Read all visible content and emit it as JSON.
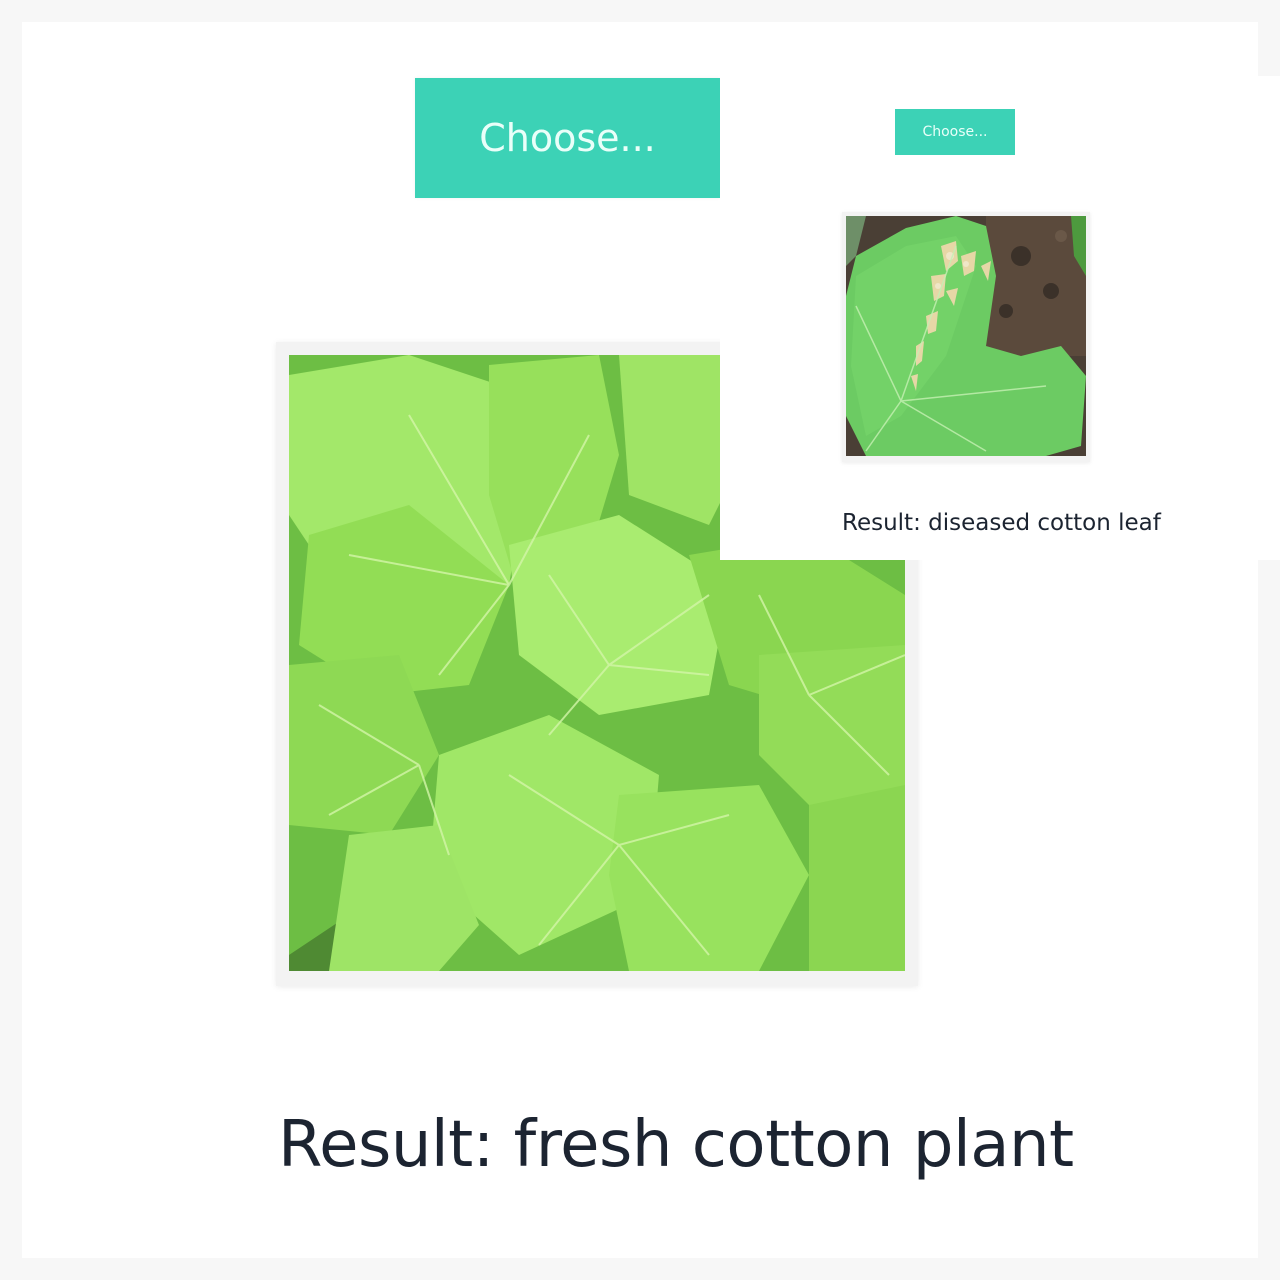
{
  "main": {
    "choose_label": "Choose...",
    "image_alt": "cotton plant leaves",
    "result_text": "Result: fresh cotton plant"
  },
  "inset": {
    "choose_label": "Choose...",
    "image_alt": "cotton leaf with disease spots",
    "result_text": "Result: diseased cotton leaf"
  },
  "colors": {
    "accent": "#3cd2b6",
    "text": "#1c2431",
    "leaf_fresh": "#8fe05a",
    "leaf_diseased": "#6cc763"
  }
}
